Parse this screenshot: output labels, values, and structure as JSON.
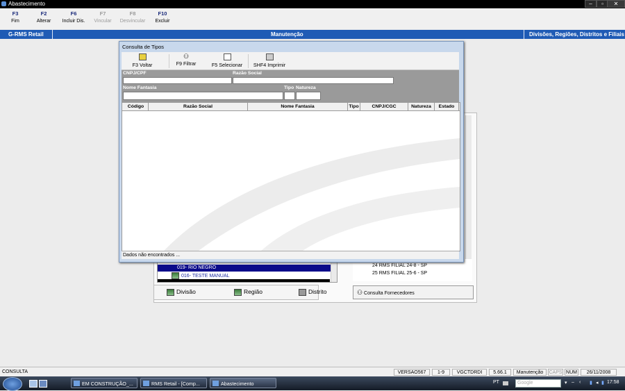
{
  "window": {
    "title": "Abastecimento"
  },
  "fkeys": [
    {
      "key": "F3",
      "label": "Fim",
      "enabled": true
    },
    {
      "key": "F2",
      "label": "Alterar",
      "enabled": true
    },
    {
      "key": "F6",
      "label": "Incluir Dis.",
      "enabled": true
    },
    {
      "key": "F7",
      "label": "Vincular",
      "enabled": false
    },
    {
      "key": "F8",
      "label": "Desvincular",
      "enabled": false
    },
    {
      "key": "F10",
      "label": "Excluir",
      "enabled": true
    }
  ],
  "header": {
    "left": "G-RMS Retail",
    "center": "Manutenção",
    "right": "Divisões, Regiões, Distritos e Filiais"
  },
  "tree": {
    "items": [
      {
        "label": "019- RIO NEGRO",
        "selected": true
      },
      {
        "label": "016- TESTE MANUAL",
        "selected": false
      }
    ]
  },
  "list": {
    "items": [
      "24 RMS FILIAL 24-8 - SP",
      "25 RMS FILIAL 25-6 - SP"
    ]
  },
  "tabs": {
    "divisao": "Divisão",
    "regiao": "Região",
    "distrito": "Distrito"
  },
  "consulta_fornecedores": "Consulta Fornecedores",
  "dialog": {
    "title": "Consulta de Tipos",
    "toolbar": {
      "voltar": "F3 Voltar",
      "filtrar": "F9 Filtrar",
      "selecionar": "F5 Selecionar",
      "imprimir": "SHF4 Imprimir"
    },
    "form": {
      "cnpj_label": "CNPJ/CPF",
      "razao_label": "Razão Social",
      "fantasia_label": "Nome Fantasia",
      "tipo_label": "Tipo",
      "natureza_label": "Natureza",
      "cnpj_value": "",
      "razao_value": "",
      "fantasia_value": "",
      "tipo_value": "",
      "natureza_value": ""
    },
    "columns": [
      "Código",
      "Razão Social",
      "Nome Fantasia",
      "Tipo",
      "CNPJ/CGC",
      "Natureza",
      "Estado"
    ],
    "status": "Dados não encontrados ..."
  },
  "statusbar": {
    "left": "CONSULTA",
    "cells": [
      "VERSAO567",
      "1-9",
      "VGCTDRDI",
      "5.66.1",
      "Manutenção",
      "CAPS",
      "NUM",
      "26/11/2008"
    ]
  },
  "taskbar": {
    "buttons": [
      "EM CONSTRUÇÃO_...",
      "RMS Retail - [Comp...",
      "Abastecimento"
    ],
    "lang": "PT",
    "search_placeholder": "Google",
    "time": "17:58"
  },
  "colors": {
    "header_blue": "#1f5bb5",
    "selected_row": "#0a0a8a",
    "fkey_text": "#1a2a7a"
  }
}
